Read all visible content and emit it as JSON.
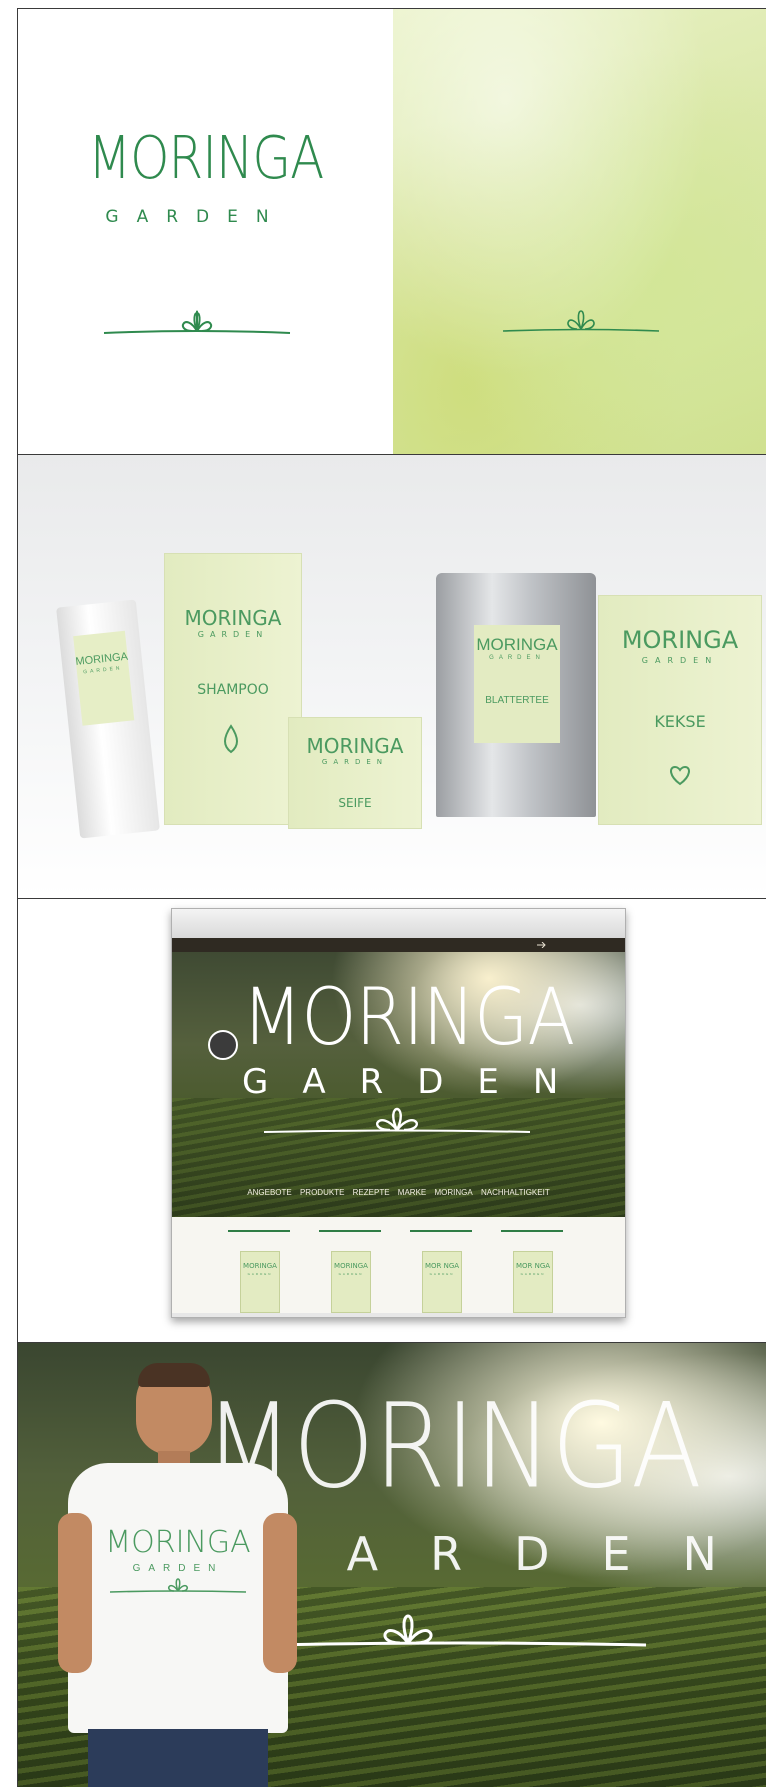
{
  "brand": {
    "name": "MORINGA",
    "sub": "GARDEN"
  },
  "panel1": {
    "logo_name": "MORINGA",
    "logo_sub": "GARDEN"
  },
  "panel2": {
    "tube": {
      "brand": "MORINGA",
      "sub": "GARDEN"
    },
    "shampoo": {
      "brand": "MORINGA",
      "sub": "GARDEN",
      "product": "SHAMPOO"
    },
    "seife": {
      "brand": "MORINGA",
      "sub": "GARDEN",
      "product": "SEIFE"
    },
    "blattertee": {
      "brand": "MORINGA",
      "sub": "GARDEN",
      "product": "BLATTERTEE"
    },
    "kekse": {
      "brand": "MORINGA",
      "sub": "GARDEN",
      "product": "KEKSE"
    }
  },
  "panel3": {
    "hero_brand": "MORINGA",
    "hero_sub": "GARDEN",
    "nav": [
      "ANGEBOTE",
      "PRODUKTE",
      "REZEPTE",
      "MARKE",
      "MORINGA",
      "NACHHALTIGKEIT"
    ],
    "products": [
      {
        "brand": "MORINGA",
        "sub": "GARDEN"
      },
      {
        "brand": "MORINGA",
        "sub": "GARDEN"
      },
      {
        "brand": "MOR NGA",
        "sub": "GARDEN"
      },
      {
        "brand": "MOR NGA",
        "sub": "GARDEN"
      }
    ]
  },
  "panel4": {
    "hero_brand": "MORINGA",
    "hero_sub": "GARDEN",
    "shirt_brand": "MORINGA",
    "shirt_sub": "GARDEN"
  },
  "colors": {
    "brand_green": "#2f8a4e",
    "pale_green": "#e3ebc2",
    "dark_bar": "#2f2a22"
  },
  "icons": [
    "sprout-icon",
    "heart-icon",
    "drop-icon",
    "arrow-right-icon",
    "badge-icon"
  ]
}
